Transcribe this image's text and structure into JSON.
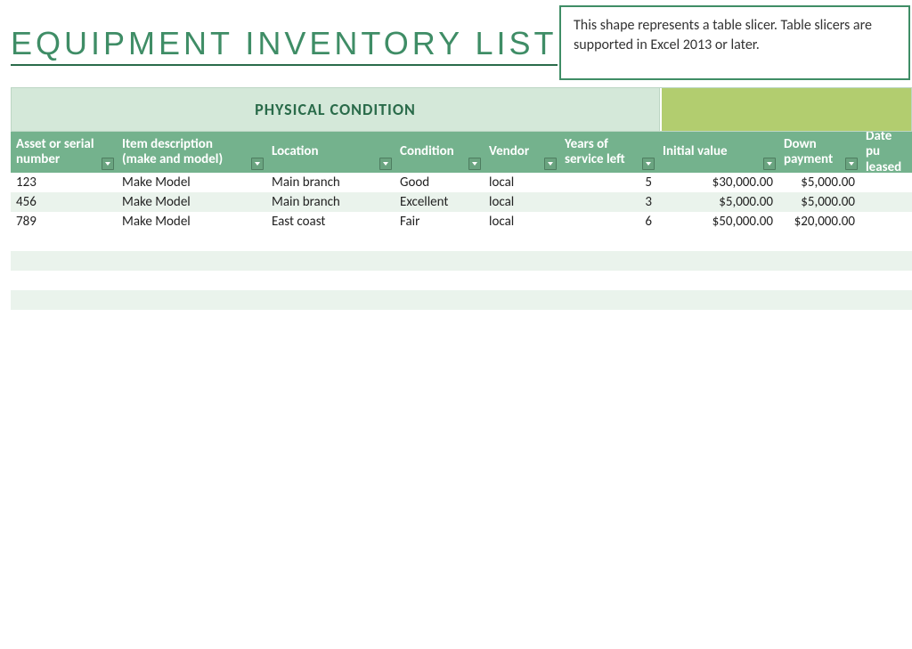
{
  "title": "EQUIPMENT INVENTORY LIST",
  "slicer_notice": "This shape represents a table slicer. Table slicers are supported in Excel 2013 or later.",
  "sections": {
    "left_label": "PHYSICAL CONDITION",
    "right_label": ""
  },
  "columns": {
    "asset": "Asset or serial\nnumber",
    "desc": "Item description\n(make and model)",
    "loc": "Location",
    "cond": "Condition",
    "vend": "Vendor",
    "years": "Years of\nservice left",
    "init": "Initial value",
    "down": "Down\npayment",
    "date": "Date pu\nleased"
  },
  "rows": [
    {
      "asset": "123",
      "desc": "Make Model",
      "loc": "Main branch",
      "cond": "Good",
      "vend": "local",
      "years": "5",
      "init": "$30,000.00",
      "down": "$5,000.00",
      "date": ""
    },
    {
      "asset": "456",
      "desc": "Make Model",
      "loc": "Main branch",
      "cond": "Excellent",
      "vend": "local",
      "years": "3",
      "init": "$5,000.00",
      "down": "$5,000.00",
      "date": ""
    },
    {
      "asset": "789",
      "desc": "Make Model",
      "loc": "East coast",
      "cond": "Fair",
      "vend": "local",
      "years": "6",
      "init": "$50,000.00",
      "down": "$20,000.00",
      "date": ""
    }
  ]
}
